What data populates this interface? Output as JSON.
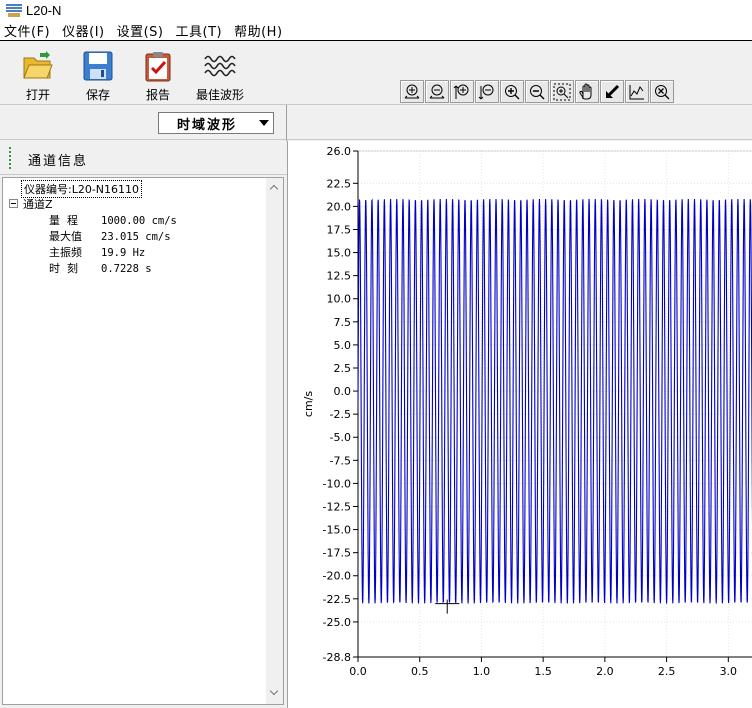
{
  "window": {
    "title": "L20-N"
  },
  "menu": [
    {
      "label": "文件(F)"
    },
    {
      "label": "仪器(I)"
    },
    {
      "label": "设置(S)"
    },
    {
      "label": "工具(T)"
    },
    {
      "label": "帮助(H)"
    }
  ],
  "toolbar": {
    "open_label": "打开",
    "save_label": "保存",
    "report_label": "报告",
    "best_wave_label": "最佳波形"
  },
  "view_select": {
    "value": "时域波形"
  },
  "panel": {
    "title": "通道信息"
  },
  "tree": {
    "device": "仪器编号:L20-N16110",
    "channel": "通道Z",
    "props": [
      {
        "key": "量  程",
        "value": "1000.00 cm/s"
      },
      {
        "key": "最大值",
        "value": "23.015 cm/s"
      },
      {
        "key": "主振频",
        "value": "19.9 Hz"
      },
      {
        "key": "时  刻",
        "value": "0.7228 s"
      }
    ]
  },
  "colors": {
    "series": "#0000c8",
    "panel_bg": "#f0f0f0",
    "grid": "#c8c8c8"
  },
  "chart_data": {
    "type": "line",
    "xlabel": "",
    "ylabel": "cm/s",
    "xlim": [
      0.0,
      3.2
    ],
    "ylim": [
      -28.8,
      26.0
    ],
    "yticks": [
      26.0,
      22.5,
      20.0,
      17.5,
      15.0,
      12.5,
      10.0,
      7.5,
      5.0,
      2.5,
      0.0,
      -2.5,
      -5.0,
      -7.5,
      -10.0,
      -12.5,
      -15.0,
      -17.5,
      -20.0,
      -22.5,
      -25.0,
      -28.8
    ],
    "ytick_labels": [
      "26.0",
      "22.5",
      "20.0",
      "17.5",
      "15.0",
      "12.5",
      "10.0",
      "7.5",
      "5.0",
      "2.5",
      "0.0",
      "-2.5",
      "-5.0",
      "-7.5",
      "-10.0",
      "-12.5",
      "-15.0",
      "-17.5",
      "-20.0",
      "-22.5",
      "-25.0",
      "-28.8"
    ],
    "xticks": [
      0.0,
      0.5,
      1.0,
      1.5,
      2.0,
      2.5,
      3.0
    ],
    "xtick_labels": [
      "0.0",
      "0.5",
      "1.0",
      "1.5",
      "2.0",
      "2.5",
      "3.0"
    ],
    "series": [
      {
        "frequency_hz": 19.9,
        "max": 20.8,
        "min": -23.0
      }
    ],
    "marker": {
      "x": 0.7228,
      "y": -23.015
    }
  }
}
